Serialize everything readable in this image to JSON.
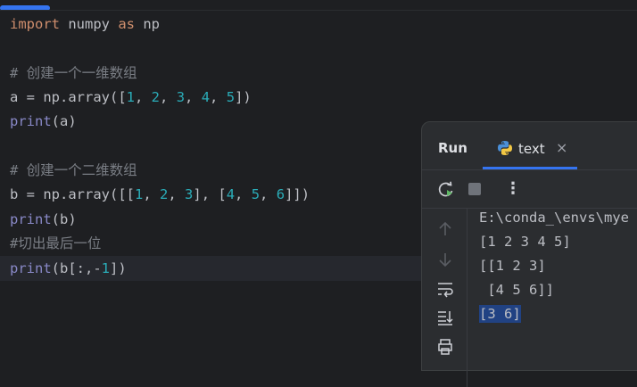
{
  "editor": {
    "lines": [
      {
        "id": "l1",
        "text_import": "import",
        "text_numpy": " numpy ",
        "text_as": "as",
        "text_np": " np"
      },
      {
        "id": "l3",
        "comment": "# 创建一个一维数组"
      },
      {
        "id": "l4",
        "a_assign": "a = np.array([",
        "n1": "1",
        "n2": "2",
        "n3": "3",
        "n4": "4",
        "n5": "5",
        "close": "])"
      },
      {
        "id": "l5",
        "fn": "print",
        "arg": "(a)"
      },
      {
        "id": "l7",
        "comment": "# 创建一个二维数组"
      },
      {
        "id": "l8",
        "b_assign": "b = np.array([[",
        "n1": "1",
        "n2": "2",
        "n3": "3",
        "n4": "4",
        "n5": "5",
        "n6": "6"
      },
      {
        "id": "l9",
        "fn": "print",
        "arg": "(b)"
      },
      {
        "id": "l10",
        "comment": "#切出最后一位"
      },
      {
        "id": "l11",
        "fn": "print",
        "arg_open": "(b[:,-",
        "n1": "1",
        "arg_close": "])"
      }
    ]
  },
  "run_panel": {
    "title": "Run",
    "tab_label": "text",
    "tab_close": "×",
    "toolbar": {
      "more": "⋮"
    },
    "console_lines": [
      "E:\\conda_\\envs\\mye",
      "[1 2 3 4 5]",
      "[[1 2 3]",
      " [4 5 6]]",
      "[3 6]"
    ]
  },
  "colors": {
    "accent": "#3574f0",
    "keyword": "#cf8e6d",
    "number": "#2aacb8",
    "comment": "#7a7e85",
    "builtin": "#8888c6"
  }
}
